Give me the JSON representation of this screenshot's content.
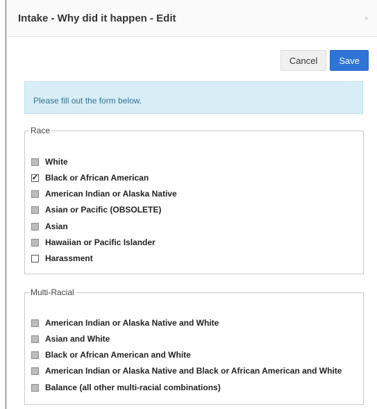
{
  "modal": {
    "title": "Intake - Why did it happen - Edit",
    "close_label": "×",
    "cancel_label": "Cancel",
    "save_label": "Save",
    "info_text": "Please fill out the form below.",
    "colors": {
      "primary": "#2e74d6",
      "info_bg": "#d9edf7"
    }
  },
  "race": {
    "legend": "Race",
    "options": [
      {
        "label": "White",
        "state": "disabled"
      },
      {
        "label": "Black or African American",
        "state": "checked"
      },
      {
        "label": "American Indian or Alaska Native",
        "state": "disabled"
      },
      {
        "label": "Asian or Pacific (OBSOLETE)",
        "state": "disabled"
      },
      {
        "label": "Asian",
        "state": "disabled"
      },
      {
        "label": "Hawaiian or Pacific Islander",
        "state": "disabled"
      },
      {
        "label": "Harassment",
        "state": "unchecked"
      }
    ]
  },
  "multi_racial": {
    "legend": "Multi-Racial",
    "options": [
      {
        "label": "American Indian or Alaska Native and White",
        "state": "disabled"
      },
      {
        "label": "Asian and White",
        "state": "disabled"
      },
      {
        "label": "Black or African American and White",
        "state": "disabled"
      },
      {
        "label": "American Indian or Alaska Native and Black or African American and White",
        "state": "disabled"
      },
      {
        "label": "Balance (all other multi-racial combinations)",
        "state": "disabled"
      }
    ]
  }
}
